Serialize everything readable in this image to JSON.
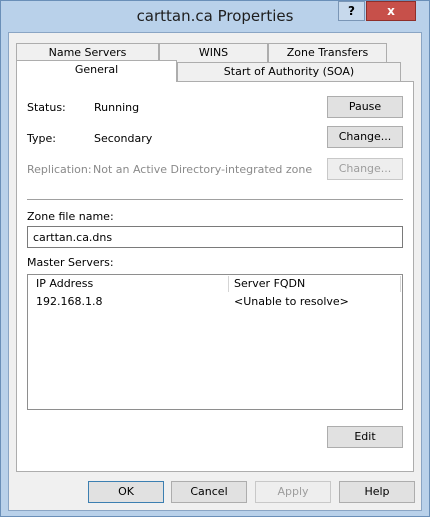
{
  "window": {
    "title": "carttan.ca Properties",
    "help_glyph": "?",
    "close_glyph": "x"
  },
  "tabs": {
    "row_back": [
      "Name Servers",
      "WINS",
      "Zone Transfers"
    ],
    "row_front": [
      "General",
      "Start of Authority (SOA)"
    ],
    "active": "General"
  },
  "general": {
    "status_label": "Status:",
    "status_value": "Running",
    "pause_button": "Pause",
    "type_label": "Type:",
    "type_value": "Secondary",
    "type_change_button": "Change...",
    "replication_label": "Replication:",
    "replication_value": "Not an Active Directory-integrated zone",
    "replication_change_button": "Change...",
    "zone_file_label": "Zone file name:",
    "zone_file_value": "carttan.ca.dns",
    "master_servers_label": "Master Servers:",
    "columns": [
      "IP Address",
      "Server FQDN"
    ],
    "rows": [
      {
        "ip": "192.168.1.8",
        "fqdn": "<Unable to resolve>"
      }
    ],
    "edit_button": "Edit"
  },
  "footer": {
    "ok": "OK",
    "cancel": "Cancel",
    "apply": "Apply",
    "help": "Help"
  }
}
